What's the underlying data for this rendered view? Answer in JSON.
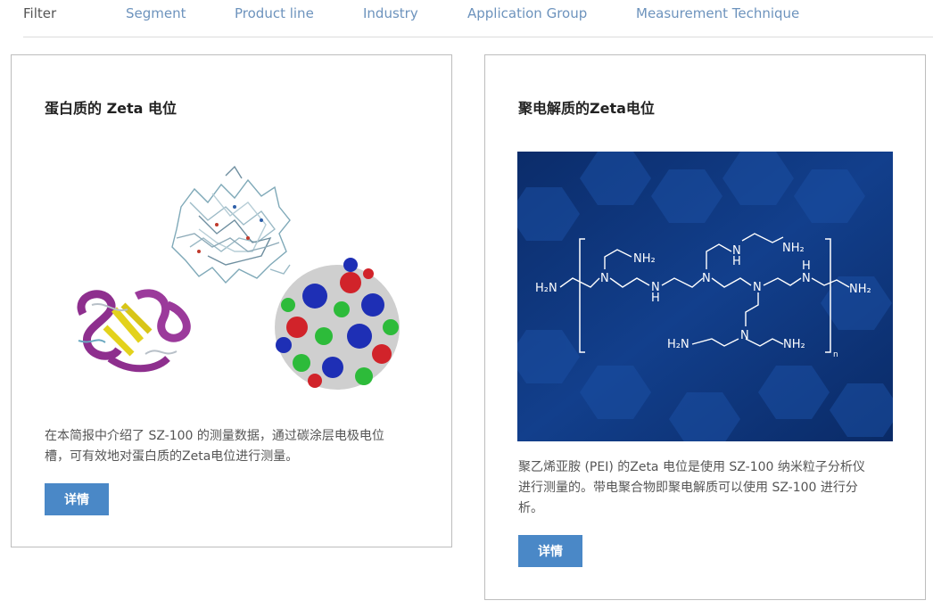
{
  "filter": {
    "label": "Filter",
    "items": [
      "Segment",
      "Product line",
      "Industry",
      "Application Group",
      "Measurement Technique"
    ]
  },
  "cards": [
    {
      "title": "蛋白质的 Zeta 电位",
      "desc_line1": "在本简报中介绍了 SZ-100 的测量数据，通过碳涂层电极电位",
      "desc_line2": "槽，可有效地对蛋白质的Zeta电位进行测量。",
      "button": "详情"
    },
    {
      "title": "聚电解质的Zeta电位",
      "desc_line1": "聚乙烯亚胺 (PEI) 的Zeta 电位是使用 SZ-100 纳米粒子分析仪",
      "desc_line2": "进行测量的。带电聚合物即聚电解质可以使用 SZ-100 进行分",
      "desc_line3": "析。",
      "button": "详情"
    }
  ],
  "molecule": {
    "n1": "H₂N",
    "n2": "NH₂",
    "n3": "NH₂",
    "n4": "NH₂",
    "n5": "NH₂",
    "n6": "H₂N",
    "n7": "NH₂",
    "nh1": "N",
    "nh2": "H",
    "sub": "n"
  },
  "colors": {
    "accent": "#4a88c7",
    "link": "#6d93bd",
    "pei_bg": "#0f3a80"
  }
}
